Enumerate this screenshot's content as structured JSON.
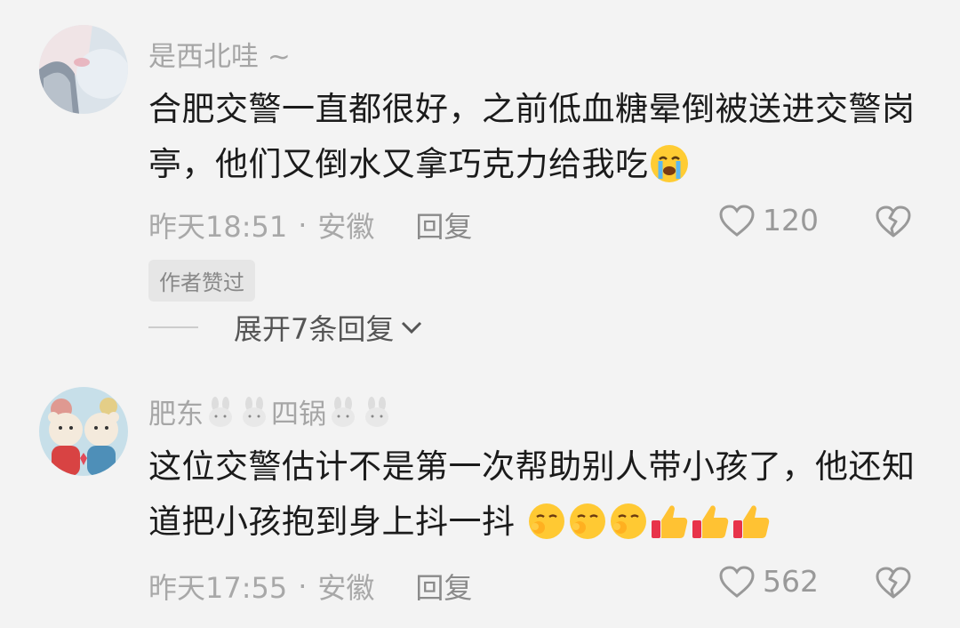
{
  "comments": [
    {
      "username": "是西北哇 ~",
      "text": "合肥交警一直都很好，之前低血糖晕倒被送进交警岗亭，他们又倒水又拿巧克力给我吃",
      "emoji": "crying-face-icon",
      "time": "昨天18:51",
      "location": "安徽",
      "reply_label": "回复",
      "likes": "120",
      "author_tag": "作者赞过",
      "expand_label": "展开7条回复"
    },
    {
      "username_parts": [
        "肥东",
        "四锅"
      ],
      "text": "这位交警估计不是第一次帮助别人带小孩了，他还知道把小孩抱到身上抖一抖",
      "emojis": [
        "smirk-face-icon",
        "smirk-face-icon",
        "smirk-face-icon",
        "thumbs-up-icon",
        "thumbs-up-icon",
        "thumbs-up-icon"
      ],
      "time": "昨天17:55",
      "location": "安徽",
      "reply_label": "回复",
      "likes": "562"
    }
  ],
  "colors": {
    "background": "#f3f3f3",
    "text": "#1b1b1b",
    "muted": "#a6a6a6"
  },
  "separator": "·"
}
